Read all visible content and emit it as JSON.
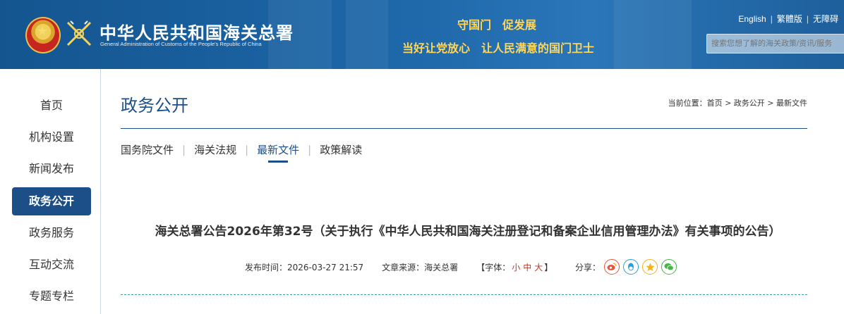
{
  "header": {
    "brand_cn": "中华人民共和国海关总署",
    "brand_en": "General Administration of Customs of the People's Republic of China",
    "slogan_line1": "守国门　促发展",
    "slogan_line2": "当好让党放心　让人民满意的国门卫士",
    "links": [
      "English",
      "繁體版",
      "无障碍"
    ],
    "search_placeholder": "搜索您想了解的海关政策/资讯/服务"
  },
  "sidebar": {
    "items": [
      {
        "label": "首页",
        "active": false
      },
      {
        "label": "机构设置",
        "active": false
      },
      {
        "label": "新闻发布",
        "active": false
      },
      {
        "label": "政务公开",
        "active": true
      },
      {
        "label": "政务服务",
        "active": false
      },
      {
        "label": "互动交流",
        "active": false
      },
      {
        "label": "专题专栏",
        "active": false
      }
    ]
  },
  "main": {
    "section_title": "政务公开",
    "breadcrumb": "当前位置：首页 > 政务公开 > 最新文件",
    "tabs": [
      {
        "label": "国务院文件",
        "active": false
      },
      {
        "label": "海关法规",
        "active": false
      },
      {
        "label": "最新文件",
        "active": true
      },
      {
        "label": "政策解读",
        "active": false
      }
    ],
    "article": {
      "title": "海关总署公告2026年第32号（关于执行《中华人民共和国海关注册登记和备案企业信用管理办法》有关事项的公告）",
      "publish_label": "发布时间：",
      "publish_time": "2026-03-27 21:57",
      "source_label": "文章来源：",
      "source": "海关总署",
      "font_label_open": "【字体：",
      "font_small": "小",
      "font_medium": "中",
      "font_large": "大",
      "font_label_close": "】",
      "share_label": "分享："
    }
  },
  "colors": {
    "primary": "#1c4f87",
    "header_bg": "#1d66a8",
    "slogan": "#ffd75a",
    "divider_dashed": "#3aa0a8"
  },
  "share_icons": [
    "weibo-icon",
    "qq-icon",
    "qzone-icon",
    "wechat-icon"
  ]
}
